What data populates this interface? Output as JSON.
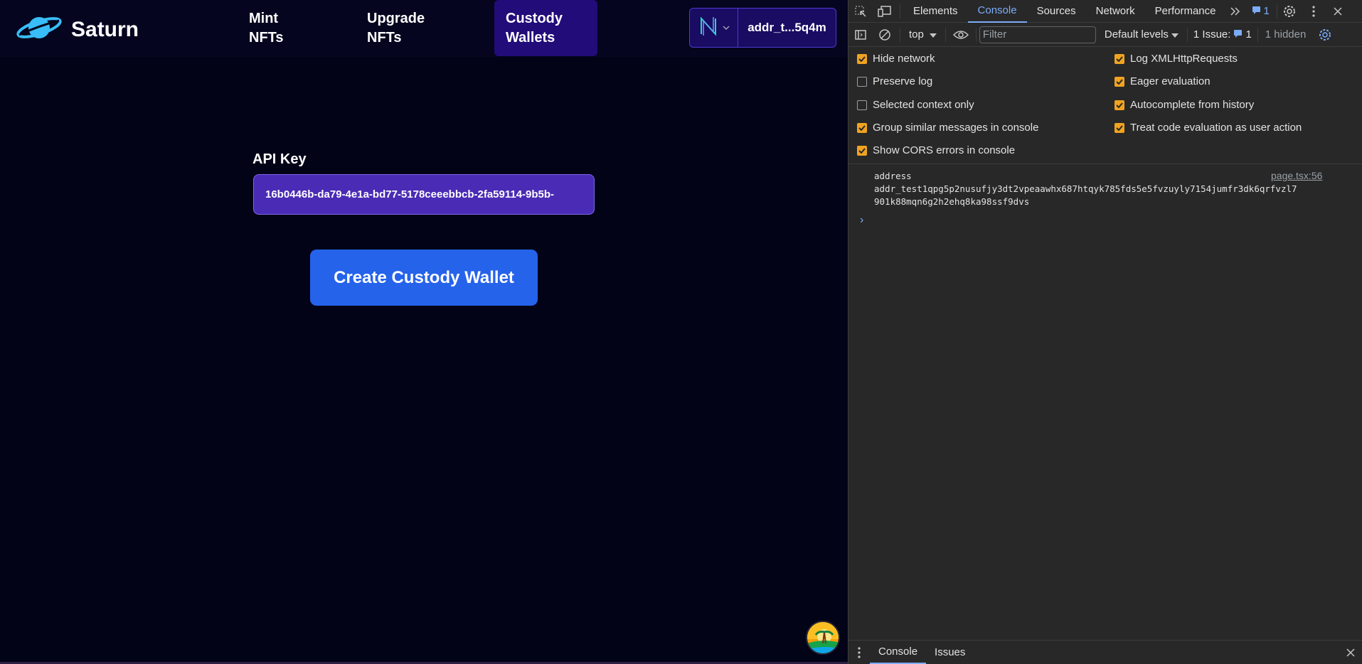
{
  "app": {
    "brand": "Saturn",
    "nav": [
      {
        "line1": "Mint",
        "line2": "NFTs"
      },
      {
        "line1": "Upgrade",
        "line2": "NFTs"
      },
      {
        "line1": "Custody",
        "line2": "Wallets"
      }
    ],
    "wallet": {
      "address_short": "addr_t...5q4m",
      "network_icon": "n-logo-icon"
    },
    "api": {
      "label": "API Key",
      "value": "16b0446b-da79-4e1a-bd77-5178ceeebbcb-2fa59114-9b5b-"
    },
    "create_button": "Create Custody Wallet",
    "colors": {
      "bg": "#030318",
      "active_nav": "#220c7a",
      "input": "#4a2bb5",
      "button": "#2563eb"
    }
  },
  "devtools": {
    "tabs": [
      "Elements",
      "Console",
      "Sources",
      "Network",
      "Performance"
    ],
    "active_tab": "Console",
    "issues_badge": "1",
    "toolbar": {
      "context": "top",
      "filter_placeholder": "Filter",
      "levels": "Default levels",
      "issues_label": "1 Issue:",
      "issues_count": "1",
      "hidden": "1 hidden"
    },
    "settings_left": [
      {
        "label": "Hide network",
        "checked": true
      },
      {
        "label": "Preserve log",
        "checked": false
      },
      {
        "label": "Selected context only",
        "checked": false
      },
      {
        "label": "Group similar messages in console",
        "checked": true
      },
      {
        "label": "Show CORS errors in console",
        "checked": true
      }
    ],
    "settings_right": [
      {
        "label": "Log XMLHttpRequests",
        "checked": true
      },
      {
        "label": "Eager evaluation",
        "checked": true
      },
      {
        "label": "Autocomplete from history",
        "checked": true
      },
      {
        "label": "Treat code evaluation as user action",
        "checked": true
      }
    ],
    "message": {
      "line1": "address",
      "line2": "addr_test1qpg5p2nusufjy3dt2vpeaawhx687htqyk785fds5e5fvzuyly7154jumfr3dk6qrfvzl7",
      "line3": "901k88mqn6g2h2ehq8ka98ssf9dvs",
      "source": "page.tsx:56"
    },
    "drawer_tabs": [
      "Console",
      "Issues"
    ]
  }
}
